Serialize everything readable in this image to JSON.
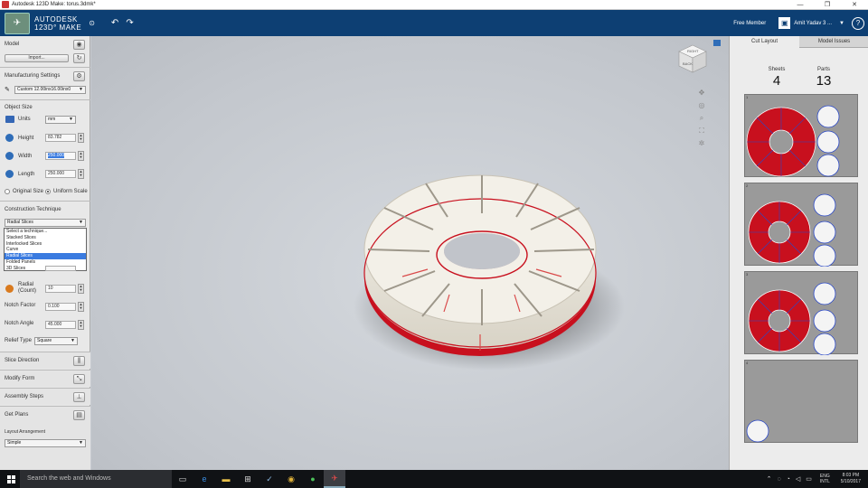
{
  "window": {
    "title": "Autodesk 123D Make: torus.3dmk*",
    "controls": [
      "—",
      "❐",
      "✕"
    ]
  },
  "header": {
    "brand_line1": "AUTODESK",
    "brand_line2": "123D° MAKE",
    "member": "Free Member",
    "user": "Amit Yadav 3 ...",
    "help": "?"
  },
  "left_panel": {
    "model": {
      "label": "Model",
      "import_label": "Import..."
    },
    "manufacturing": {
      "label": "Manufacturing Settings",
      "preset": "Custom 12.00inx16.00inx0"
    },
    "object_size": {
      "label": "Object Size",
      "units_label": "Units",
      "units_value": "mm",
      "height_label": "Height",
      "height_value": "83.782",
      "width_label": "Width",
      "width_value": "250.000",
      "length_label": "Length",
      "length_value": "250.000",
      "original_size": "Original Size",
      "uniform_scale": "Uniform Scale"
    },
    "construction": {
      "label": "Construction Technique",
      "selected": "Radial Slices",
      "options": [
        "Select a technique...",
        "Stacked Slices",
        "Interlocked Slices",
        "Curve",
        "Radial Slices",
        "Folded Panels",
        "3D Slices"
      ],
      "radial_label_1": "Radial",
      "radial_label_2": "(Count)",
      "radial_value": "10",
      "notch_factor_label": "Notch Factor",
      "notch_factor_value": "0.100",
      "notch_angle_label": "Notch Angle",
      "notch_angle_value": "45.000",
      "relief_label": "Relief Type",
      "relief_value": "Square"
    },
    "sections": {
      "slice_direction": "Slice Direction",
      "modify_form": "Modify Form",
      "assembly_steps": "Assembly Steps",
      "get_plans": "Get Plans"
    },
    "layout": {
      "label": "Layout Arrangement",
      "value": "Simple"
    }
  },
  "viewcube": {
    "top": "RIGHT",
    "front": "BACK"
  },
  "right_panel": {
    "tabs": [
      "Cut Layout",
      "Model Issues"
    ],
    "sheets_label": "Sheets",
    "sheets_value": "4",
    "parts_label": "Parts",
    "parts_value": "13",
    "sheet_numbers": [
      "1",
      "2",
      "3",
      "4"
    ]
  },
  "taskbar": {
    "search_placeholder": "Search the web and Windows",
    "lang_1": "ENG",
    "lang_2": "INTL",
    "time": "8:03 PM",
    "date": "5/10/2017"
  },
  "colors": {
    "header_bg": "#0d3f73",
    "slice_red": "#c8101e",
    "panel_bg": "#e8e8e8",
    "selection": "#3a7be0"
  }
}
